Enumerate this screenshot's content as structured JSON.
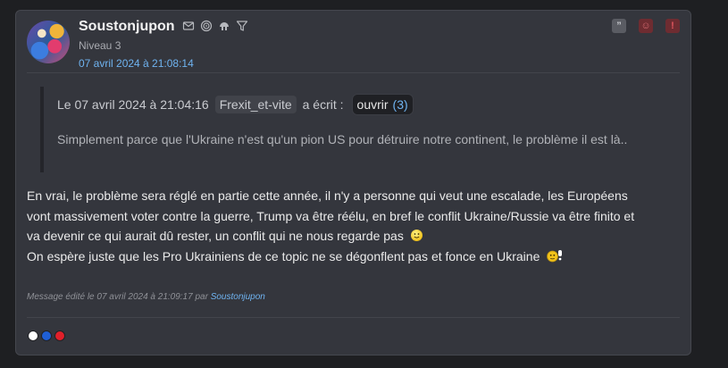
{
  "post": {
    "username": "Soustonjupon",
    "level": "Niveau 3",
    "date": "07 avril 2024 à 21:08:14",
    "user_icons": [
      "mail-icon",
      "spiral-icon",
      "globe-icon",
      "filter-icon"
    ],
    "actions": {
      "quote_label": "”",
      "mp_label": "☺",
      "alert_label": "!"
    },
    "quote": {
      "prefix": "Le 07 avril 2024 à 21:04:16",
      "author": "Frexit_et-vite",
      "suffix": "a écrit :",
      "open_label": "ouvrir",
      "open_count": "(3)",
      "text": "Simplement parce que l'Ukraine n'est qu'un pion US pour détruire notre continent, le problème il est là.."
    },
    "message": {
      "line1": "En vrai, le problème sera réglé en partie cette année, il n'y a personne qui veut une escalade, les Européens",
      "line2": "vont massivement voter contre la guerre, Trump va être réélu, en bref le conflit Ukraine/Russie va être finito et",
      "line3": "va devenir ce qui aurait dû rester, un conflit qui ne nous regarde pas",
      "line4": "On espère juste que les Pro Ukrainiens de ce topic ne se dégonflent pas et fonce en Ukraine"
    },
    "edit": {
      "prefix": "Message édité le 07 avril 2024 à 21:09:17 par",
      "author": "Soustonjupon"
    },
    "flag_colors": [
      "#ffffff",
      "#1f5fd6",
      "#e0202a"
    ]
  }
}
